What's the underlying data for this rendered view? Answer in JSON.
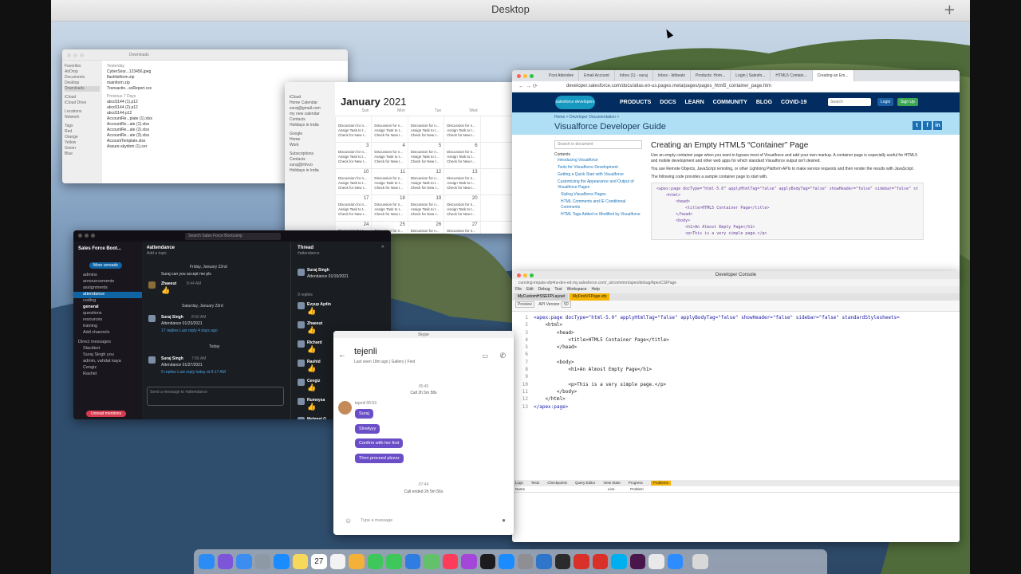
{
  "mission_control": {
    "title": "Desktop",
    "add_symbol": "+"
  },
  "finder": {
    "title": "Downloads",
    "sidebar": [
      "Favorites",
      "AirDrop",
      "Documents",
      "Desktop",
      "Downloads",
      "iCloud",
      "iCloud Drive",
      "Locations",
      "Network",
      "Tags",
      "Red",
      "Orange",
      "Yellow",
      "Green",
      "Blue"
    ],
    "section_yesterday": "Yesterday",
    "files_yesterday": [
      "CyberSour...123456.jpeg",
      "flashlistform.zip",
      "mainform.zip",
      "Transactio...ssReport.csv"
    ],
    "section_previous": "Previous 7 Days",
    "files_previous": [
      "abcd1144 (1).p12",
      "abcd1144 (2).p12",
      "abcd1144.p12",
      "AccountRe...plate (1).xlsx",
      "AccountRe...ate (1).xlsx",
      "AccountRe...ate (2).xlsx",
      "AccountRe...ate (3).xlsx",
      "AccountTemplate.xlsx",
      "Assure-skydom (1).cer"
    ]
  },
  "calendar": {
    "month": "January",
    "year": "2021",
    "sidebar": [
      "iCloud",
      "Home Calendar",
      "suraj@gmail.com",
      "my new calendar",
      "Contacts",
      "Holidays in India",
      "Google",
      "Home",
      "Work",
      "Subscriptions",
      "Contacts",
      "suraj@mfv.io",
      "Holidays in India"
    ],
    "day_headers": [
      "Sun",
      "Mon",
      "Tue",
      "Wed"
    ],
    "weeks": [
      [
        "",
        "",
        "",
        ""
      ],
      [
        "3",
        "4",
        "5",
        "6"
      ],
      [
        "10",
        "11",
        "12",
        "13"
      ],
      [
        "17",
        "18",
        "19",
        "20"
      ],
      [
        "24",
        "25",
        "26",
        "27"
      ]
    ],
    "event_text": "Discussion for n... Assign Task to t... Check for New I..."
  },
  "browser": {
    "tabs": [
      "Post Attendee",
      "Email Account",
      "Inbox (1) - suraj",
      "Inbox - bitbeatz",
      "Products: Hom...",
      "Login | Salesfo...",
      "HTML5 Contain...",
      "Creating an Em..."
    ],
    "url": "developer.salesforce.com/docs/atlas.en-us.pages.meta/pages/pages_html5_container_page.htm",
    "logo": "salesforce developers",
    "nav": [
      "PRODUCTS",
      "DOCS",
      "LEARN",
      "COMMUNITY",
      "BLOG",
      "COVID-19"
    ],
    "search_placeholder": "Search",
    "login": "Login",
    "signup": "Sign Up",
    "breadcrumb": "Home > Developer Documentation >",
    "guide_title": "Visualforce Developer Guide",
    "toc_search": "Search in document",
    "toc": [
      "Contents",
      "Introducing Visualforce",
      "Tools for Visualforce Development",
      "Getting a Quick Start with Visualforce",
      "Customizing the Appearance and Output of Visualforce Pages",
      "Styling Visualforce Pages",
      "HTML Comments and IE Conditional Comments",
      "HTML Tags Added or Modified by Visualforce"
    ],
    "heading": "Creating an Empty HTML5 “Container” Page",
    "para1": "Use an empty container page when you want to bypass most of Visualforce and add your own markup. A container page is especially useful for HTML5 and mobile development and other web apps for which standard Visualforce output isn’t desired.",
    "para2": "You use Remote Objects, JavaScript remoting, or other Lightning Platform APIs to make service requests and then render the results with JavaScript.",
    "para3": "The following code provides a sample container page to start with."
  },
  "dev_console": {
    "title": "Developer Console",
    "url": "cunning-impala-vfp4ra-dev-ed.my.salesforce.com/_ui/common/apex/debug/ApexCSIPage",
    "menu": [
      "File",
      "Edit",
      "Debug",
      "Test",
      "Workspace",
      "Help"
    ],
    "file_tabs": [
      "MyCustomHSSEFPLayout",
      "MyFirstVFPage.vfp"
    ],
    "options": [
      "Preview",
      "API Version:",
      "50"
    ],
    "line_numbers": [
      "1",
      "2",
      "3",
      "4",
      "5",
      "6",
      "7",
      "8",
      "9",
      "10",
      "11",
      "12",
      "13"
    ],
    "code_lines": [
      "<apex:page docType=\"html-5.0\" applyHtmlTag=\"false\" applyBodyTag=\"false\" showHeader=\"false\" sidebar=\"false\" standardStylesheets=",
      "    <html>",
      "        <head>",
      "            <title>HTML5 Container Page</title>",
      "        </head>",
      "",
      "        <body>",
      "            <h1>An Almost Empty Page</h1>",
      "",
      "            <p>This is a very simple page.</p>",
      "        </body>",
      "    </html>",
      "</apex:page>"
    ],
    "bottom_tabs": [
      "Logs",
      "Tests",
      "Checkpoints",
      "Query Editor",
      "View State",
      "Progress",
      "Problems"
    ],
    "problem_headers": [
      "Name",
      "Line",
      "Problem"
    ]
  },
  "slack": {
    "workspace": "Sales Force Boot...",
    "search": "Search Sales Force Bootcamp",
    "more_unreads": "More unreads",
    "channels": [
      "admins",
      "announcements",
      "assignments",
      "attendance",
      "coding",
      "general",
      "questions",
      "resources",
      "training",
      "Add channels"
    ],
    "dm_header": "Direct messages",
    "dms": [
      "Slackbot",
      "Suraj Singh you",
      "admin, vahdat kaya",
      "Cengiz",
      "Rashid"
    ],
    "unread_mentions": "Unread mentions",
    "channel_name": "#attendance",
    "channel_sub": "Add a topic",
    "date1": "Friday, January 22nd",
    "msg1_text": "Suraj can you accept me pls",
    "msg2_author": "Zhaeeut",
    "msg2_time": "8:44 AM",
    "date2": "Saturday, January 23rd",
    "msg3_author": "Suraj Singh",
    "msg3_time": "8:56 AM",
    "msg3_text": "Attendance 01/23/2021",
    "msg3_replies": "17 replies   Last reply 4 days ago",
    "date3": "Today",
    "msg4_author": "Suraj Singh",
    "msg4_time": "7:56 AM",
    "msg4_text": "Attendance 01/27/2021",
    "msg4_replies": "9 replies   Last reply today at 9:17 AM",
    "composer": "Send a message to #attendance",
    "thread_title": "Thread",
    "thread_sub": "#attendance",
    "thread_author": "Suraj Singh",
    "thread_text": "Attendance 01/19/2021",
    "thread_replies": "9 replies",
    "thread_people": [
      "Evyup Aydin",
      "Zhaeeut",
      "Richard",
      "Rashid",
      "Cengiz",
      "Rumeysa",
      "Mehmet G"
    ]
  },
  "skype": {
    "window_title": "Skype",
    "contact": "tejenli",
    "status": "Last seen 18m ago  |  Gallery  |  Find",
    "time1": "05:40",
    "call1": "Call 2h 5m 58s",
    "sender": "tejenli 05:53",
    "bubbles": [
      "Suraj",
      "Slowlyyy",
      "Confirm with her first",
      "Thnn proceed plzzzz"
    ],
    "time2": "07:44",
    "call2": "Call ended 2h 5m 56s",
    "placeholder": "Type a message"
  },
  "dock_icons": [
    "finder-icon",
    "siri-icon",
    "mail-icon",
    "launchpad-icon",
    "safari-icon",
    "notes-icon",
    "calendar-icon",
    "reminders-icon",
    "photos-icon",
    "messages-icon",
    "facetime-icon",
    "files-icon",
    "maps-icon",
    "music-icon",
    "podcasts-icon",
    "tv-icon",
    "app-store-icon",
    "system-preferences-icon",
    "xcode-icon",
    "terminal-icon",
    "acrobat-icon",
    "vpn-icon",
    "skype-icon",
    "slack-icon",
    "chrome-icon",
    "zoom-icon",
    "trash-icon"
  ],
  "dock_calendar_day": "27",
  "colors": {
    "salesforce_navy": "#032d60",
    "salesforce_blue": "#1798c1",
    "slack_selected": "#1164a3",
    "skype_bubble": "#6a4ec8",
    "devconsole_accent": "#f5b400"
  }
}
